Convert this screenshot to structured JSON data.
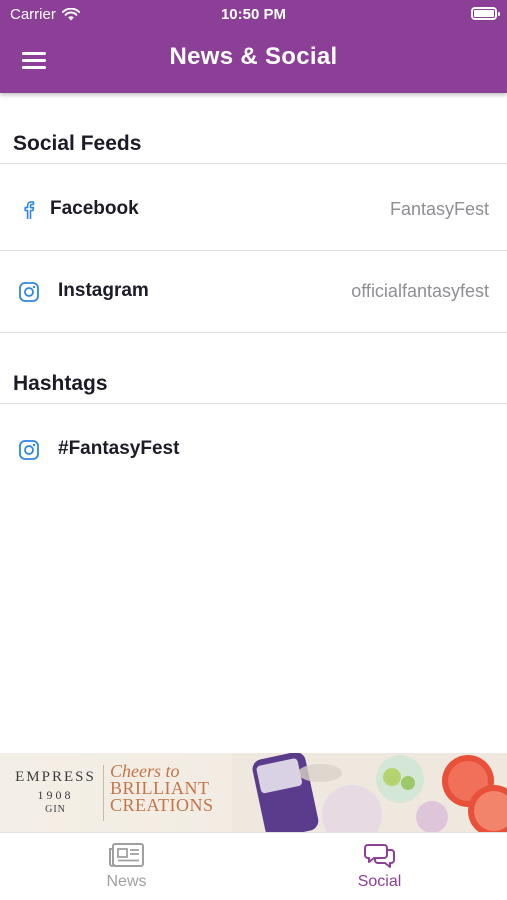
{
  "status_bar": {
    "carrier": "Carrier",
    "time": "10:50 PM",
    "battery_level": 1.0
  },
  "header": {
    "title": "News & Social",
    "menu_icon": "hamburger-menu-icon"
  },
  "social_feeds": {
    "heading": "Social Feeds",
    "items": [
      {
        "label": "Facebook",
        "value": "FantasyFest",
        "icon": "facebook-icon"
      },
      {
        "label": "Instagram",
        "value": "officialfantasyfest",
        "icon": "instagram-icon"
      }
    ]
  },
  "hashtags": {
    "heading": "Hashtags",
    "items": [
      {
        "label": "#FantasyFest",
        "icon": "instagram-icon"
      }
    ]
  },
  "ad": {
    "brand_line1": "EMPRESS",
    "brand_line2": "1908",
    "brand_line3": "GIN",
    "slogan_line1": "Cheers to",
    "slogan_line2": "BRILLIANT",
    "slogan_line3": "CREATIONS"
  },
  "tabs": [
    {
      "label": "News",
      "icon": "newspaper-icon",
      "active": false
    },
    {
      "label": "Social",
      "icon": "chat-bubbles-icon",
      "active": true
    }
  ],
  "colors": {
    "brand": "#8b3f96",
    "link_blue": "#2f86e0",
    "inactive": "#a0a0a0",
    "secondary_text": "#8e8e93"
  }
}
